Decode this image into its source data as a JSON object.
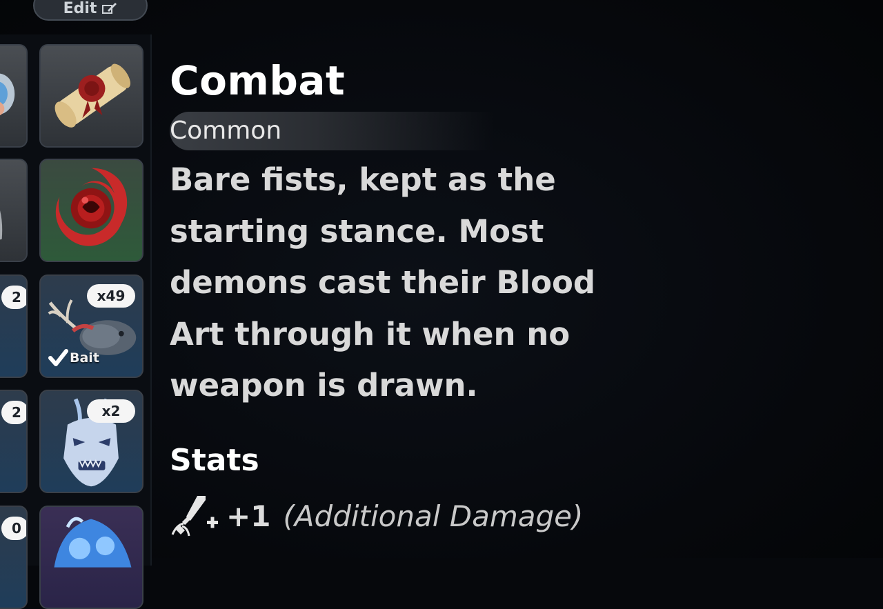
{
  "toolbar": {
    "edit_label": "Edit"
  },
  "inventory": {
    "left_column_badges": [
      "2",
      "2",
      "0"
    ],
    "right_column": [
      {
        "icon": "scroll-icon"
      },
      {
        "icon": "blood-orb-icon"
      },
      {
        "icon": "deer-fish-bait-icon",
        "count": "x49",
        "tag": "Bait"
      },
      {
        "icon": "oni-mask-icon",
        "count": "x2"
      },
      {
        "icon": "blue-flame-icon"
      }
    ]
  },
  "item": {
    "name": "Combat",
    "rarity": "Common",
    "description": "Bare fists, kept as the starting stance. Most demons cast their Blood Art through it when no weapon is drawn.",
    "description_lines": [
      "Bare fists, kept as the",
      "starting stance. Most",
      "demons cast their Blood",
      "Art through it when no",
      "weapon is drawn."
    ]
  },
  "stats": {
    "heading": "Stats",
    "entries": [
      {
        "icon": "damage-sword-icon",
        "value": "+1",
        "label": "(Additional Damage)"
      }
    ]
  },
  "colors": {
    "background": "#06080c",
    "text_primary": "#ffffff",
    "text_secondary": "#d9d9d9",
    "badge": "#f5f5f5"
  }
}
